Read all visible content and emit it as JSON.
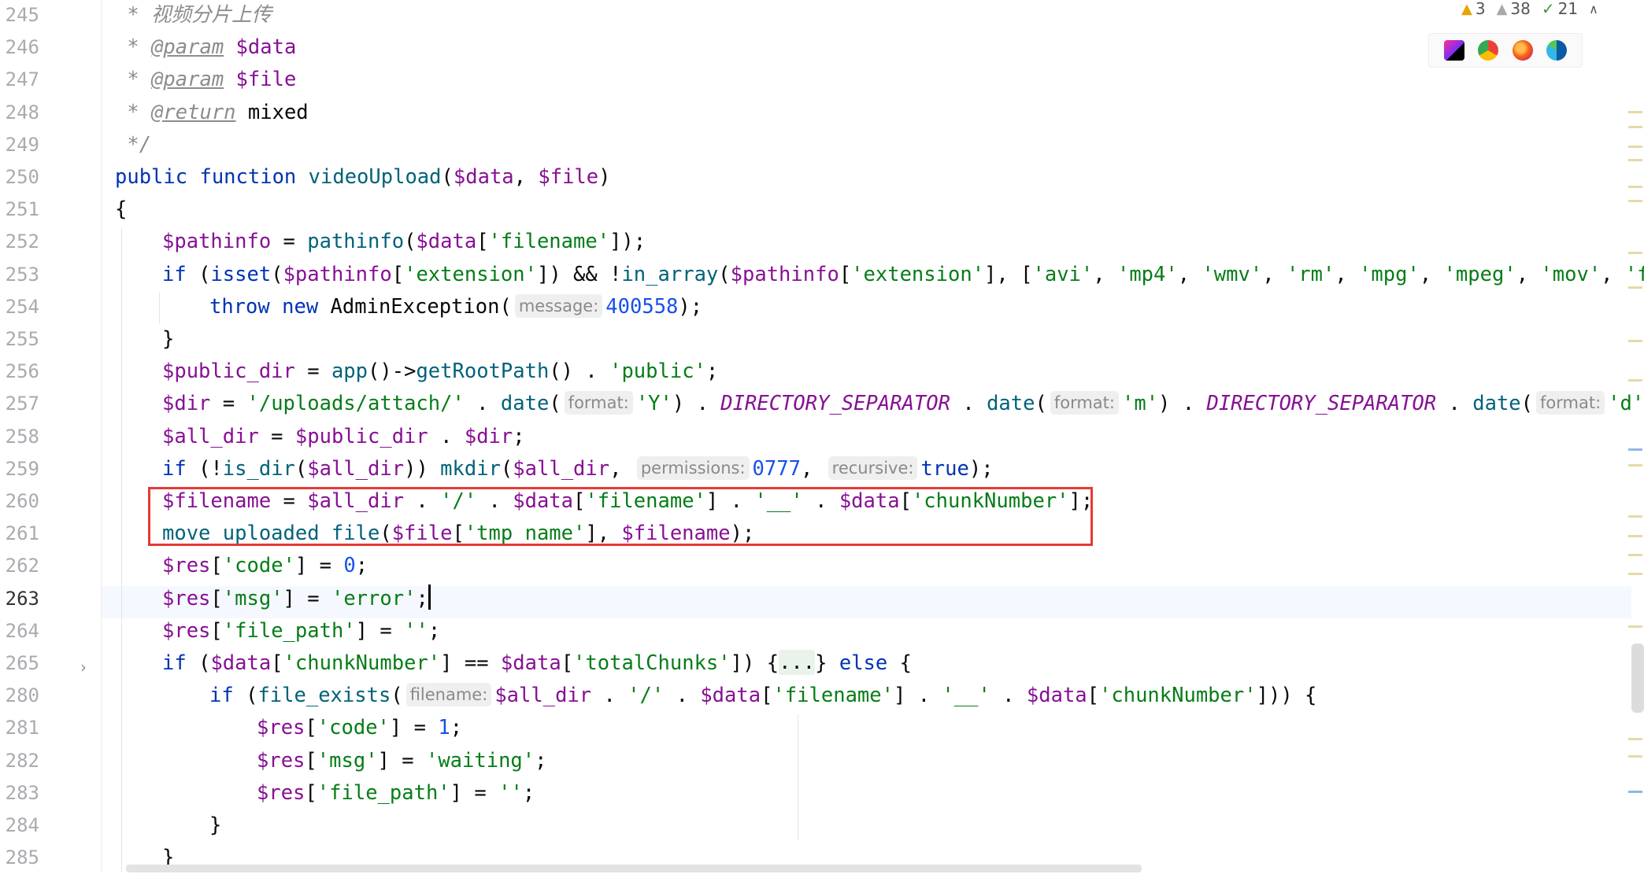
{
  "inspections": {
    "errors": "3",
    "warnings": "38",
    "ok": "21"
  },
  "browser_icons": [
    "phpstorm-icon",
    "chrome-icon",
    "firefox-icon",
    "edge-icon"
  ],
  "colors": {
    "keyword": "#0033b3",
    "variable": "#871094",
    "function": "#00627a",
    "string": "#067d17",
    "number": "#1750eb",
    "comment": "#8c8c8c",
    "highlight_box": "#e53935"
  },
  "current_line": "263",
  "editor": {
    "lines": [
      {
        "n": "245",
        "indent": 0,
        "tokens": [
          {
            "t": " * 视频分片上传",
            "c": "cm"
          }
        ]
      },
      {
        "n": "246",
        "indent": 0,
        "tokens": [
          {
            "t": " * ",
            "c": "cm"
          },
          {
            "t": "@param",
            "c": "tag"
          },
          {
            "t": " ",
            "c": "cm"
          },
          {
            "t": "$data",
            "c": "var"
          }
        ]
      },
      {
        "n": "247",
        "indent": 0,
        "tokens": [
          {
            "t": " * ",
            "c": "cm"
          },
          {
            "t": "@param",
            "c": "tag"
          },
          {
            "t": " ",
            "c": "cm"
          },
          {
            "t": "$file",
            "c": "var"
          }
        ]
      },
      {
        "n": "248",
        "indent": 0,
        "tokens": [
          {
            "t": " * ",
            "c": "cm"
          },
          {
            "t": "@return",
            "c": "tag"
          },
          {
            "t": " ",
            "c": "cm"
          },
          {
            "t": "mixed",
            "c": "plain"
          }
        ]
      },
      {
        "n": "249",
        "indent": 0,
        "tokens": [
          {
            "t": " */",
            "c": "cm"
          }
        ]
      },
      {
        "n": "250",
        "indent": 0,
        "tokens": [
          {
            "t": "public function ",
            "c": "kw"
          },
          {
            "t": "videoUpload",
            "c": "fn"
          },
          {
            "t": "(",
            "c": "plain"
          },
          {
            "t": "$data",
            "c": "var"
          },
          {
            "t": ", ",
            "c": "plain"
          },
          {
            "t": "$file",
            "c": "var"
          },
          {
            "t": ")",
            "c": "plain"
          }
        ]
      },
      {
        "n": "251",
        "indent": 0,
        "tokens": [
          {
            "t": "{",
            "c": "plain"
          }
        ]
      },
      {
        "n": "252",
        "indent": 1,
        "tokens": [
          {
            "t": "$pathinfo",
            "c": "var"
          },
          {
            "t": " = ",
            "c": "plain"
          },
          {
            "t": "pathinfo",
            "c": "fn"
          },
          {
            "t": "(",
            "c": "plain"
          },
          {
            "t": "$data",
            "c": "var"
          },
          {
            "t": "[",
            "c": "plain"
          },
          {
            "t": "'filename'",
            "c": "str"
          },
          {
            "t": "]);",
            "c": "plain"
          }
        ]
      },
      {
        "n": "253",
        "indent": 1,
        "tokens": [
          {
            "t": "if",
            "c": "kw"
          },
          {
            "t": " (",
            "c": "plain"
          },
          {
            "t": "isset",
            "c": "kw"
          },
          {
            "t": "(",
            "c": "plain"
          },
          {
            "t": "$pathinfo",
            "c": "var"
          },
          {
            "t": "[",
            "c": "plain"
          },
          {
            "t": "'extension'",
            "c": "str"
          },
          {
            "t": "]) && !",
            "c": "plain"
          },
          {
            "t": "in_array",
            "c": "fn"
          },
          {
            "t": "(",
            "c": "plain"
          },
          {
            "t": "$pathinfo",
            "c": "var"
          },
          {
            "t": "[",
            "c": "plain"
          },
          {
            "t": "'extension'",
            "c": "str"
          },
          {
            "t": "], [",
            "c": "plain"
          },
          {
            "t": "'avi'",
            "c": "str"
          },
          {
            "t": ", ",
            "c": "plain"
          },
          {
            "t": "'mp4'",
            "c": "str"
          },
          {
            "t": ", ",
            "c": "plain"
          },
          {
            "t": "'wmv'",
            "c": "str"
          },
          {
            "t": ", ",
            "c": "plain"
          },
          {
            "t": "'rm'",
            "c": "str"
          },
          {
            "t": ", ",
            "c": "plain"
          },
          {
            "t": "'mpg'",
            "c": "str"
          },
          {
            "t": ", ",
            "c": "plain"
          },
          {
            "t": "'mpeg'",
            "c": "str"
          },
          {
            "t": ", ",
            "c": "plain"
          },
          {
            "t": "'mov'",
            "c": "str"
          },
          {
            "t": ", ",
            "c": "plain"
          },
          {
            "t": "'flv",
            "c": "str"
          }
        ]
      },
      {
        "n": "254",
        "indent": 2,
        "tokens": [
          {
            "t": "throw new ",
            "c": "kw"
          },
          {
            "t": "AdminException",
            "c": "plain"
          },
          {
            "t": "(",
            "c": "plain"
          },
          {
            "t": "message:",
            "c": "hint"
          },
          {
            "t": "400558",
            "c": "num"
          },
          {
            "t": ");",
            "c": "plain"
          }
        ]
      },
      {
        "n": "255",
        "indent": 1,
        "tokens": [
          {
            "t": "}",
            "c": "plain"
          }
        ]
      },
      {
        "n": "256",
        "indent": 1,
        "tokens": [
          {
            "t": "$public_dir",
            "c": "var"
          },
          {
            "t": " = ",
            "c": "plain"
          },
          {
            "t": "app",
            "c": "fn"
          },
          {
            "t": "()->",
            "c": "plain"
          },
          {
            "t": "getRootPath",
            "c": "fn"
          },
          {
            "t": "() . ",
            "c": "plain"
          },
          {
            "t": "'public'",
            "c": "str"
          },
          {
            "t": ";",
            "c": "plain"
          }
        ]
      },
      {
        "n": "257",
        "indent": 1,
        "tokens": [
          {
            "t": "$dir",
            "c": "var"
          },
          {
            "t": " = ",
            "c": "plain"
          },
          {
            "t": "'/uploads/attach/'",
            "c": "str"
          },
          {
            "t": " . ",
            "c": "plain"
          },
          {
            "t": "date",
            "c": "fn"
          },
          {
            "t": "(",
            "c": "plain"
          },
          {
            "t": "format:",
            "c": "hint"
          },
          {
            "t": "'Y'",
            "c": "str"
          },
          {
            "t": ") . ",
            "c": "plain"
          },
          {
            "t": "DIRECTORY_SEPARATOR",
            "c": "const"
          },
          {
            "t": " . ",
            "c": "plain"
          },
          {
            "t": "date",
            "c": "fn"
          },
          {
            "t": "(",
            "c": "plain"
          },
          {
            "t": "format:",
            "c": "hint"
          },
          {
            "t": "'m'",
            "c": "str"
          },
          {
            "t": ") . ",
            "c": "plain"
          },
          {
            "t": "DIRECTORY_SEPARATOR",
            "c": "const"
          },
          {
            "t": " . ",
            "c": "plain"
          },
          {
            "t": "date",
            "c": "fn"
          },
          {
            "t": "(",
            "c": "plain"
          },
          {
            "t": "format:",
            "c": "hint"
          },
          {
            "t": "'d'",
            "c": "str"
          },
          {
            "t": ");",
            "c": "plain"
          }
        ]
      },
      {
        "n": "258",
        "indent": 1,
        "tokens": [
          {
            "t": "$all_dir",
            "c": "var"
          },
          {
            "t": " = ",
            "c": "plain"
          },
          {
            "t": "$public_dir",
            "c": "var"
          },
          {
            "t": " . ",
            "c": "plain"
          },
          {
            "t": "$dir",
            "c": "var"
          },
          {
            "t": ";",
            "c": "plain"
          }
        ]
      },
      {
        "n": "259",
        "indent": 1,
        "tokens": [
          {
            "t": "if",
            "c": "kw"
          },
          {
            "t": " (!",
            "c": "plain"
          },
          {
            "t": "is_dir",
            "c": "fn"
          },
          {
            "t": "(",
            "c": "plain"
          },
          {
            "t": "$all_dir",
            "c": "var"
          },
          {
            "t": ")) ",
            "c": "plain"
          },
          {
            "t": "mkdir",
            "c": "fn"
          },
          {
            "t": "(",
            "c": "plain"
          },
          {
            "t": "$all_dir",
            "c": "var"
          },
          {
            "t": ", ",
            "c": "plain"
          },
          {
            "t": "permissions:",
            "c": "hint"
          },
          {
            "t": "0777",
            "c": "num"
          },
          {
            "t": ", ",
            "c": "plain"
          },
          {
            "t": "recursive:",
            "c": "hint"
          },
          {
            "t": "true",
            "c": "kw"
          },
          {
            "t": ");",
            "c": "plain"
          }
        ]
      },
      {
        "n": "260",
        "indent": 1,
        "tokens": [
          {
            "t": "$filename",
            "c": "var"
          },
          {
            "t": " = ",
            "c": "plain"
          },
          {
            "t": "$all_dir",
            "c": "var"
          },
          {
            "t": " . ",
            "c": "plain"
          },
          {
            "t": "'/'",
            "c": "str"
          },
          {
            "t": " . ",
            "c": "plain"
          },
          {
            "t": "$data",
            "c": "var"
          },
          {
            "t": "[",
            "c": "plain"
          },
          {
            "t": "'filename'",
            "c": "str"
          },
          {
            "t": "] . ",
            "c": "plain"
          },
          {
            "t": "'__'",
            "c": "str"
          },
          {
            "t": " . ",
            "c": "plain"
          },
          {
            "t": "$data",
            "c": "var"
          },
          {
            "t": "[",
            "c": "plain"
          },
          {
            "t": "'chunkNumber'",
            "c": "str"
          },
          {
            "t": "];",
            "c": "plain"
          }
        ]
      },
      {
        "n": "261",
        "indent": 1,
        "tokens": [
          {
            "t": "move_uploaded_file",
            "c": "fn"
          },
          {
            "t": "(",
            "c": "plain"
          },
          {
            "t": "$file",
            "c": "var"
          },
          {
            "t": "[",
            "c": "plain"
          },
          {
            "t": "'tmp_name'",
            "c": "str"
          },
          {
            "t": "], ",
            "c": "plain"
          },
          {
            "t": "$filename",
            "c": "var"
          },
          {
            "t": ");",
            "c": "plain"
          }
        ]
      },
      {
        "n": "262",
        "indent": 1,
        "tokens": [
          {
            "t": "$res",
            "c": "var"
          },
          {
            "t": "[",
            "c": "plain"
          },
          {
            "t": "'code'",
            "c": "str"
          },
          {
            "t": "] = ",
            "c": "plain"
          },
          {
            "t": "0",
            "c": "num"
          },
          {
            "t": ";",
            "c": "plain"
          }
        ]
      },
      {
        "n": "263",
        "indent": 1,
        "tokens": [
          {
            "t": "$res",
            "c": "var"
          },
          {
            "t": "[",
            "c": "plain"
          },
          {
            "t": "'msg'",
            "c": "str"
          },
          {
            "t": "] = ",
            "c": "plain"
          },
          {
            "t": "'error'",
            "c": "str"
          },
          {
            "t": ";",
            "c": "plain"
          },
          {
            "t": "",
            "c": "caret"
          }
        ]
      },
      {
        "n": "264",
        "indent": 1,
        "tokens": [
          {
            "t": "$res",
            "c": "var"
          },
          {
            "t": "[",
            "c": "plain"
          },
          {
            "t": "'file_path'",
            "c": "str"
          },
          {
            "t": "] = ",
            "c": "plain"
          },
          {
            "t": "''",
            "c": "str"
          },
          {
            "t": ";",
            "c": "plain"
          }
        ]
      },
      {
        "n": "265",
        "indent": 1,
        "tokens": [
          {
            "t": "if",
            "c": "kw"
          },
          {
            "t": " (",
            "c": "plain"
          },
          {
            "t": "$data",
            "c": "var"
          },
          {
            "t": "[",
            "c": "plain"
          },
          {
            "t": "'chunkNumber'",
            "c": "str"
          },
          {
            "t": "] == ",
            "c": "plain"
          },
          {
            "t": "$data",
            "c": "var"
          },
          {
            "t": "[",
            "c": "plain"
          },
          {
            "t": "'totalChunks'",
            "c": "str"
          },
          {
            "t": "]) {",
            "c": "plain"
          },
          {
            "t": "...",
            "c": "ellipsis"
          },
          {
            "t": "} ",
            "c": "plain"
          },
          {
            "t": "else",
            "c": "kw"
          },
          {
            "t": " {",
            "c": "plain"
          }
        ]
      },
      {
        "n": "280",
        "indent": 2,
        "tokens": [
          {
            "t": "if",
            "c": "kw"
          },
          {
            "t": " (",
            "c": "plain"
          },
          {
            "t": "file_exists",
            "c": "fn"
          },
          {
            "t": "(",
            "c": "plain"
          },
          {
            "t": "filename:",
            "c": "hint"
          },
          {
            "t": "$all_dir",
            "c": "var"
          },
          {
            "t": " . ",
            "c": "plain"
          },
          {
            "t": "'/'",
            "c": "str"
          },
          {
            "t": " . ",
            "c": "plain"
          },
          {
            "t": "$data",
            "c": "var"
          },
          {
            "t": "[",
            "c": "plain"
          },
          {
            "t": "'filename'",
            "c": "str"
          },
          {
            "t": "] . ",
            "c": "plain"
          },
          {
            "t": "'__'",
            "c": "str"
          },
          {
            "t": " . ",
            "c": "plain"
          },
          {
            "t": "$data",
            "c": "var"
          },
          {
            "t": "[",
            "c": "plain"
          },
          {
            "t": "'chunkNumber'",
            "c": "str"
          },
          {
            "t": "])) {",
            "c": "plain"
          }
        ]
      },
      {
        "n": "281",
        "indent": 3,
        "tokens": [
          {
            "t": "$res",
            "c": "var"
          },
          {
            "t": "[",
            "c": "plain"
          },
          {
            "t": "'code'",
            "c": "str"
          },
          {
            "t": "] = ",
            "c": "plain"
          },
          {
            "t": "1",
            "c": "num"
          },
          {
            "t": ";",
            "c": "plain"
          }
        ]
      },
      {
        "n": "282",
        "indent": 3,
        "tokens": [
          {
            "t": "$res",
            "c": "var"
          },
          {
            "t": "[",
            "c": "plain"
          },
          {
            "t": "'msg'",
            "c": "str"
          },
          {
            "t": "] = ",
            "c": "plain"
          },
          {
            "t": "'waiting'",
            "c": "str"
          },
          {
            "t": ";",
            "c": "plain"
          }
        ]
      },
      {
        "n": "283",
        "indent": 3,
        "tokens": [
          {
            "t": "$res",
            "c": "var"
          },
          {
            "t": "[",
            "c": "plain"
          },
          {
            "t": "'file_path'",
            "c": "str"
          },
          {
            "t": "] = ",
            "c": "plain"
          },
          {
            "t": "''",
            "c": "str"
          },
          {
            "t": ";",
            "c": "plain"
          }
        ]
      },
      {
        "n": "284",
        "indent": 2,
        "tokens": [
          {
            "t": "}",
            "c": "plain"
          }
        ]
      },
      {
        "n": "285",
        "indent": 1,
        "tokens": [
          {
            "t": "}",
            "c": "plain"
          }
        ]
      }
    ]
  }
}
